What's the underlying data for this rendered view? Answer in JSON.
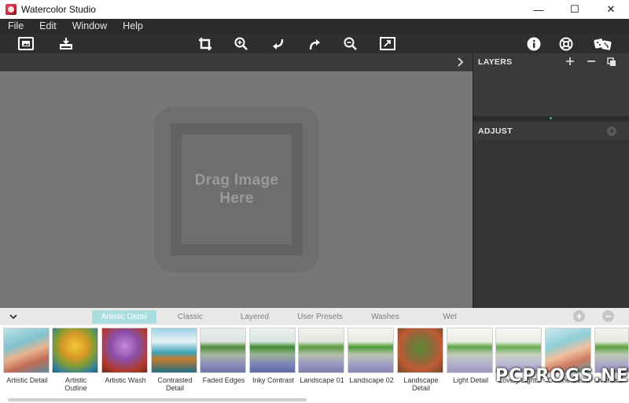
{
  "window": {
    "title": "Watercolor Studio",
    "controls": {
      "minimize": "—",
      "maximize": "☐",
      "close": "✕"
    }
  },
  "menu": [
    "File",
    "Edit",
    "Window",
    "Help"
  ],
  "toolbar": {
    "left_tools": [
      "open-image-icon",
      "save-export-icon"
    ],
    "center_tools": [
      "crop-icon",
      "zoom-in-icon",
      "undo-icon",
      "redo-icon",
      "zoom-out-icon",
      "fit-screen-icon"
    ],
    "right_tools": [
      "info-icon",
      "help-lifebuoy-icon",
      "random-dice-icon"
    ]
  },
  "canvas": {
    "drop_text": "Drag Image\nHere"
  },
  "panels": {
    "layers": {
      "title": "LAYERS"
    },
    "adjust": {
      "title": "ADJUST"
    }
  },
  "presets": {
    "tabs": [
      "Artistic Detail",
      "Classic",
      "Layered",
      "User Presets",
      "Washes",
      "Wet"
    ],
    "active_tab": "Artistic Detail",
    "items": [
      "Artistic Detail",
      "Artistic\nOutline",
      "Artistic Wash",
      "Contrasted\nDetail",
      "Faded Edges",
      "Inky Contrast",
      "Landscape 01",
      "Landscape 02",
      "Landscape\nDetail",
      "Light Detail",
      "Lovely Lights",
      "Outline Detail",
      "Overcast"
    ]
  },
  "watermark": "PCPROGS.NET",
  "colors": {
    "accent": "#a9dde0",
    "canvas": "#777777",
    "panel": "#323232"
  }
}
